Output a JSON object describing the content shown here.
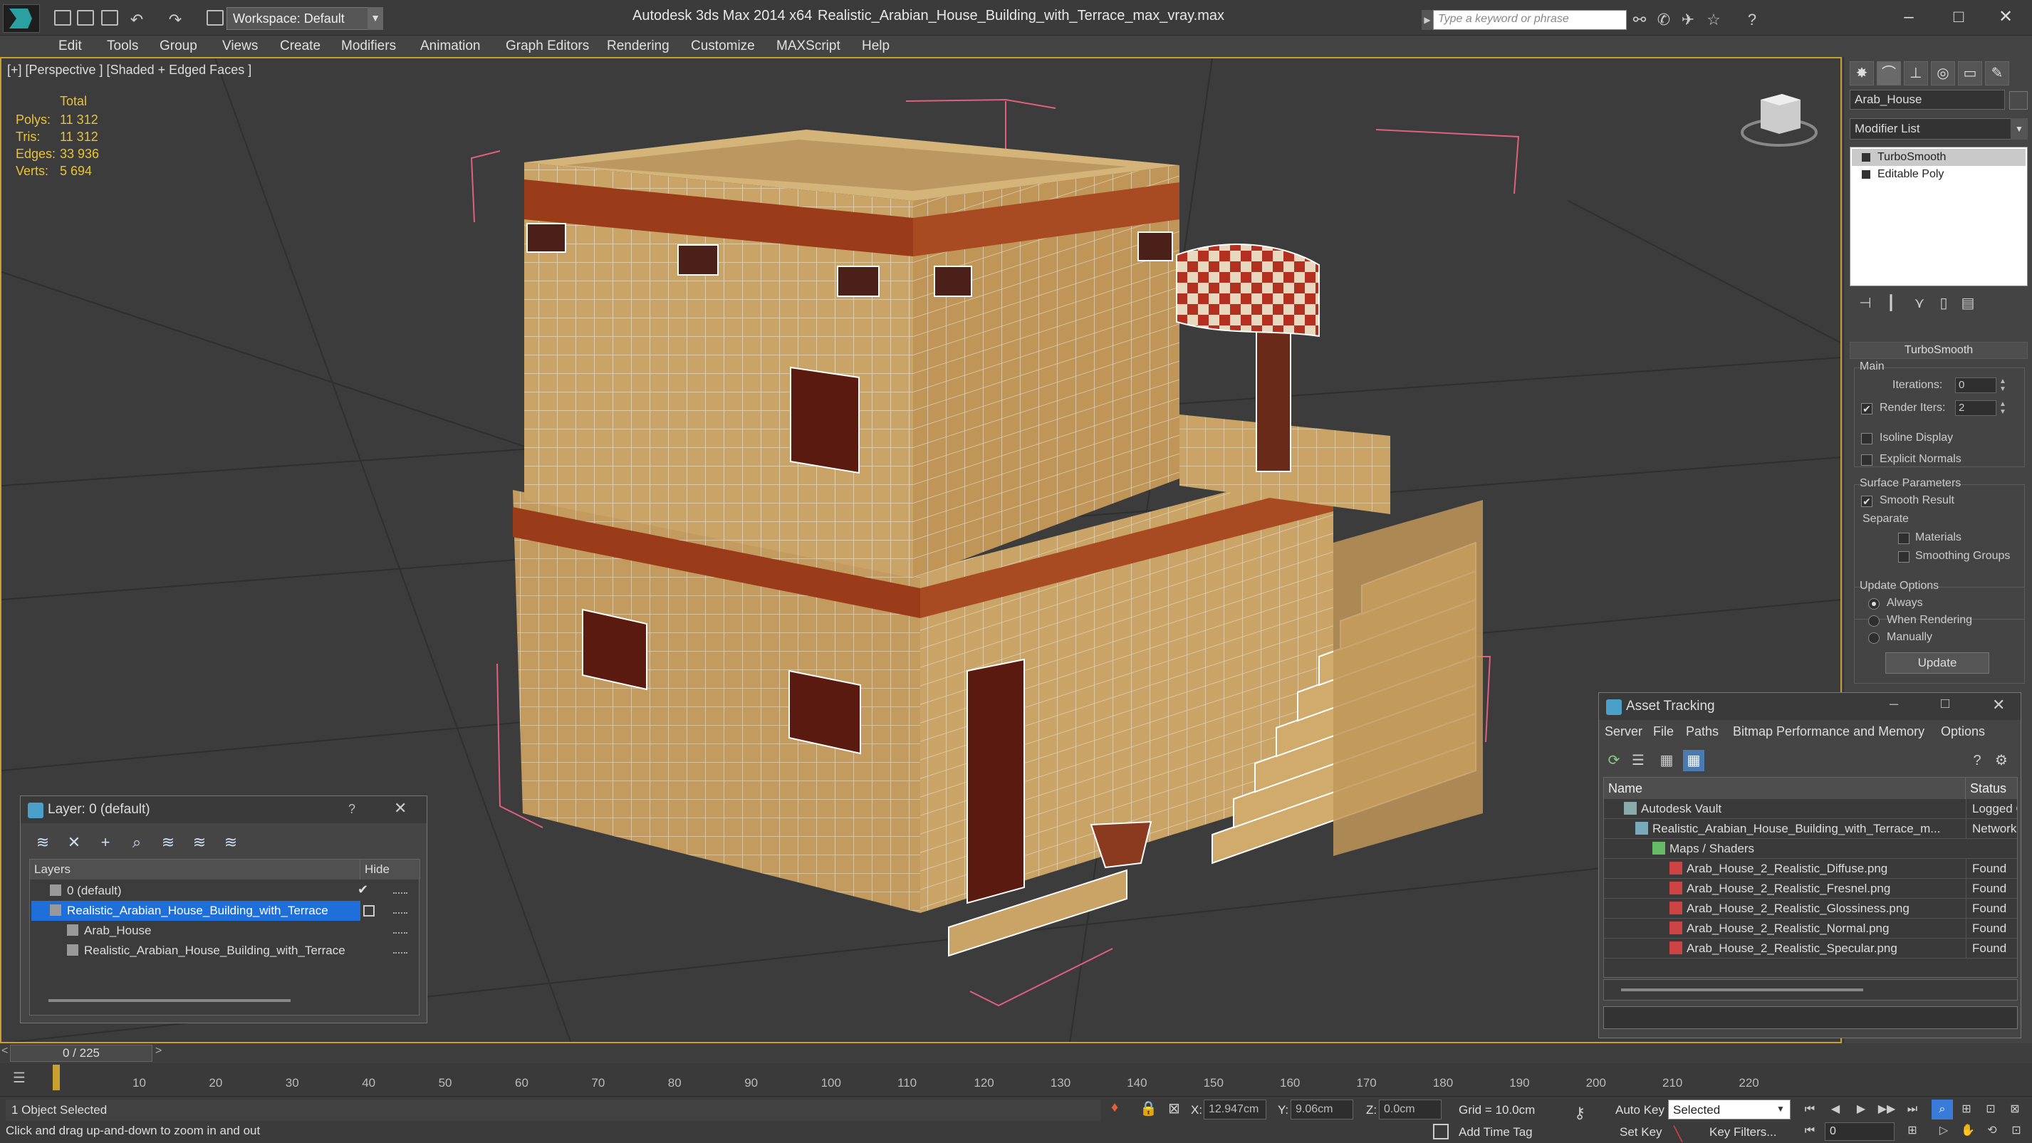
{
  "titlebar": {
    "workspace": "Workspace: Default",
    "app_title": "Autodesk 3ds Max  2014 x64",
    "file_title": "Realistic_Arabian_House_Building_with_Terrace_max_vray.max",
    "search_placeholder": "Type a keyword or phrase"
  },
  "menu": [
    "Edit",
    "Tools",
    "Group",
    "Views",
    "Create",
    "Modifiers",
    "Animation",
    "Graph Editors",
    "Rendering",
    "Customize",
    "MAXScript",
    "Help"
  ],
  "viewport": {
    "label": "[+] [Perspective ] [Shaded + Edged Faces ]",
    "stats_header": "Total",
    "stats": [
      {
        "label": "Polys:",
        "value": "11 312"
      },
      {
        "label": "Tris:",
        "value": "11 312"
      },
      {
        "label": "Edges:",
        "value": "33 936"
      },
      {
        "label": "Verts:",
        "value": "5 694"
      }
    ]
  },
  "command_panel": {
    "object_name": "Arab_House",
    "modifier_list": "Modifier List",
    "stack": [
      "TurboSmooth",
      "Editable Poly"
    ],
    "rollout_title": "TurboSmooth",
    "main_label": "Main",
    "iterations_label": "Iterations:",
    "iterations_value": "0",
    "render_iters_label": "Render Iters:",
    "render_iters_value": "2",
    "render_iters_checked": "✔",
    "isoline": "Isoline Display",
    "explicit_normals": "Explicit Normals",
    "surface_params": "Surface Parameters",
    "smooth_result": "Smooth Result",
    "smooth_result_checked": "✔",
    "separate": "Separate",
    "materials": "Materials",
    "smoothing_groups": "Smoothing Groups",
    "update_options": "Update Options",
    "always": "Always",
    "when_rendering": "When Rendering",
    "manually": "Manually",
    "update_button": "Update"
  },
  "layer_window": {
    "title": "Layer: 0 (default)",
    "help": "?",
    "col_layers": "Layers",
    "col_hide": "Hide",
    "rows": [
      {
        "name": "0 (default)"
      },
      {
        "name": "Realistic_Arabian_House_Building_with_Terrace"
      },
      {
        "name": "Arab_House"
      },
      {
        "name": "Realistic_Arabian_House_Building_with_Terrace"
      }
    ],
    "check": "✔"
  },
  "asset_window": {
    "title": "Asset Tracking",
    "menus": [
      "Server",
      "File",
      "Paths",
      "Bitmap Performance and Memory",
      "Options"
    ],
    "col_name": "Name",
    "col_status": "Status",
    "rows": [
      {
        "name": "Autodesk Vault",
        "status": "Logged O"
      },
      {
        "name": "Realistic_Arabian_House_Building_with_Terrace_m...",
        "status": "Network"
      },
      {
        "name": "Maps / Shaders",
        "status": ""
      },
      {
        "name": "Arab_House_2_Realistic_Diffuse.png",
        "status": "Found"
      },
      {
        "name": "Arab_House_2_Realistic_Fresnel.png",
        "status": "Found"
      },
      {
        "name": "Arab_House_2_Realistic_Glossiness.png",
        "status": "Found"
      },
      {
        "name": "Arab_House_2_Realistic_Normal.png",
        "status": "Found"
      },
      {
        "name": "Arab_House_2_Realistic_Specular.png",
        "status": "Found"
      }
    ]
  },
  "timeline": {
    "slider": "0 / 225",
    "ticks": [
      "10",
      "20",
      "30",
      "40",
      "50",
      "60",
      "70",
      "80",
      "90",
      "100",
      "110",
      "120",
      "130",
      "140",
      "150",
      "160",
      "170",
      "180",
      "190",
      "200",
      "210",
      "220"
    ]
  },
  "status": {
    "selection": "1 Object Selected",
    "prompt": "Click and drag up-and-down to zoom in and out",
    "x_label": "X:",
    "x_value": "12.947cm",
    "y_label": "Y:",
    "y_value": "9.06cm",
    "z_label": "Z:",
    "z_value": "0.0cm",
    "grid": "Grid = 10.0cm",
    "add_time_tag": "Add Time Tag",
    "auto_key": "Auto Key",
    "set_key": "Set Key",
    "selected_option": "Selected",
    "key_filters": "Key Filters...",
    "frame": "0"
  },
  "colors": {
    "accent_yellow": "#c8a030",
    "selection_blue": "#1e6fd9",
    "wall": "#c9a466",
    "stripe": "#9a3b1a"
  }
}
